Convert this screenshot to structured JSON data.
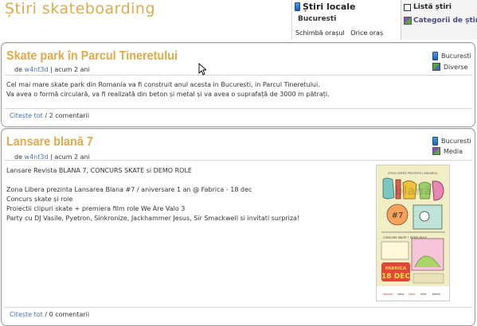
{
  "page": {
    "title": "Știri skateboarding"
  },
  "local_news": {
    "title": "Știri locale",
    "city": "Bucuresti",
    "change_city": "Schimbă orașul",
    "any_city": "Orice oraș"
  },
  "right_panel": {
    "news_list": "Listă știri",
    "categories": "Categorii de știri"
  },
  "articles": [
    {
      "title": "Skate park în Parcul Tineretului",
      "by": "de",
      "author": "w4nt3d",
      "time": "acum 2 ani",
      "tags": [
        "Bucuresti",
        "Diverse"
      ],
      "lines": [
        "Cel mai mare skate park din Romania va fi construit anul acesta in Bucuresti, in Parcul Tineretului.",
        "Va avea o formă circulară, va fi realizată din beton și metal și va avea o suprafață de 3000 m pătrați."
      ],
      "read_more": "Citește tot",
      "comments": "2 comentarii"
    },
    {
      "title": "Lansare blană 7",
      "by": "de",
      "author": "w4nt3d",
      "time": "acum 2 ani",
      "tags": [
        "Bucuresti",
        "Media"
      ],
      "lines": [
        "Lansare Revista BLANA 7, CONCURS SKATE si DEMO ROLE",
        "",
        "Zona Libera prezinta Lansarea Blana #7 / aniversare 1 an @ Fabrica - 18 dec",
        "Concurs skate și role",
        "Proiectii clipuri skate + premiera film role We Are Valo 3",
        "Party cu DJ Vasile, Pyetron, Sinkronize, Jackhammer Jesus, Sir Smackwell si invitati surpriza!"
      ],
      "read_more": "Citește tot",
      "comments": "0 comentarii",
      "poster": {
        "top_line": "ZONA LIBERĂ PREZINTĂ LANSAREA",
        "brand": "blană",
        "issue": "#7",
        "event": "CONCURS SKATE • DEMO ROLE",
        "venue": "FABRICA",
        "date": "18 DEC",
        "sponsors": [
          "fabrica",
          "vans",
          "coca",
          "nike",
          "blana"
        ]
      }
    }
  ],
  "colors": {
    "accent": "#e0a94a",
    "link": "#4a6fb5",
    "border": "#9a9a9a"
  }
}
